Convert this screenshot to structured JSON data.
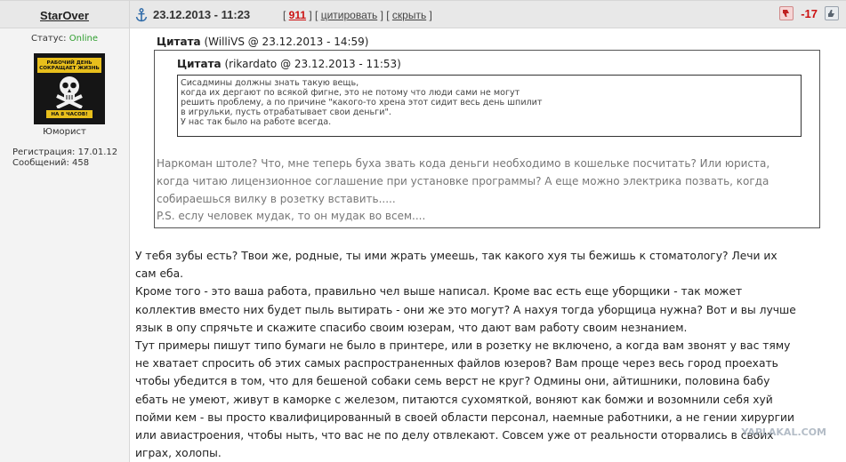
{
  "header": {
    "author": "StarOver",
    "date": "23.12.2013 - 11:23",
    "reply_count": "911",
    "quote_link": "цитировать",
    "hide_link": "скрыть",
    "score": "-17"
  },
  "user": {
    "status_label": "Статус:",
    "status_value": "Online",
    "avatar_top_text": "РАБОЧИЙ ДЕНЬ СОКРАЩАЕТ ЖИЗНЬ",
    "avatar_bottom_text": "НА 8 ЧАСОВ!",
    "rank": "Юморист",
    "registration": "Регистрация: 17.01.12",
    "messages": "Сообщений: 458"
  },
  "quote_outer": {
    "label": "Цитата",
    "attribution": "(WilliVS @ 23.12.2013 - 14:59)",
    "lines": [
      "Наркоман штоле? Что, мне теперь буха звать кода деньги необходимо в кошельке посчитать? Или юриста,",
      "когда читаю лицензионное соглашение при установке программы? А еще можно электрика позвать, когда",
      "собираешься вилку в розетку вставить.....",
      "P.S. еслу человек мудак, то он мудак во всем...."
    ]
  },
  "quote_inner": {
    "label": "Цитата",
    "attribution": "(rikardato @ 23.12.2013 - 11:53)",
    "lines": [
      "Сисадмины должны знать такую вещь,",
      "когда их дергают по всякой фигне, это не потому что люди сами не могут",
      "решить проблему, а по причине \"какого-то хрена этот сидит весь день шпилит",
      "в игрульки, пусть отрабатывает свои деньги\".",
      "У нас так было на работе всегда."
    ]
  },
  "body_lines": [
    "У тебя зубы есть? Твои же, родные, ты ими жрать умеешь, так какого хуя ты бежишь к стоматологу? Лечи их",
    "сам еба.",
    "Кроме того - это ваша работа, правильно чел выше написал. Кроме вас есть еще уборщики - так может",
    "коллектив вместо них будет пыль вытирать - они же это могут? А нахуя тогда уборщица нужна? Вот и вы лучше",
    "язык в опу спрячьте и скажите спасибо своим юзерам, что дают вам работу своим незнанием.",
    "Тут примеры пишут типо бумаги не было в принтере, или в розетку не включено, а когда вам звонят у вас тяму",
    "не хватает спросить об этих самых распространенных файлов юзеров? Вам проще через весь город проехать",
    "чтобы убедится в том, что для бешеной собаки семь верст не круг? Одмины они, айтишники, половина бабу",
    "ебать не умеют, живут в каморке с железом, питаются сухомяткой, воняют как бомжи и возомнили себя хуй",
    "пойми кем - вы просто квалифицированный в своей области персонал, наемные работники, а не гении хирургии",
    "или авиастроения, чтобы ныть, что вас не по делу отвлекают. Совсем уже от реальности оторвались в своих",
    "играх, холопы."
  ],
  "watermark": "YAPLAKAL.COM",
  "colors": {
    "header_bg": "#e8e8e8",
    "sidebar_bg": "#f3f3f3",
    "online": "#2f9e2f",
    "accent_red": "#cc1111"
  }
}
